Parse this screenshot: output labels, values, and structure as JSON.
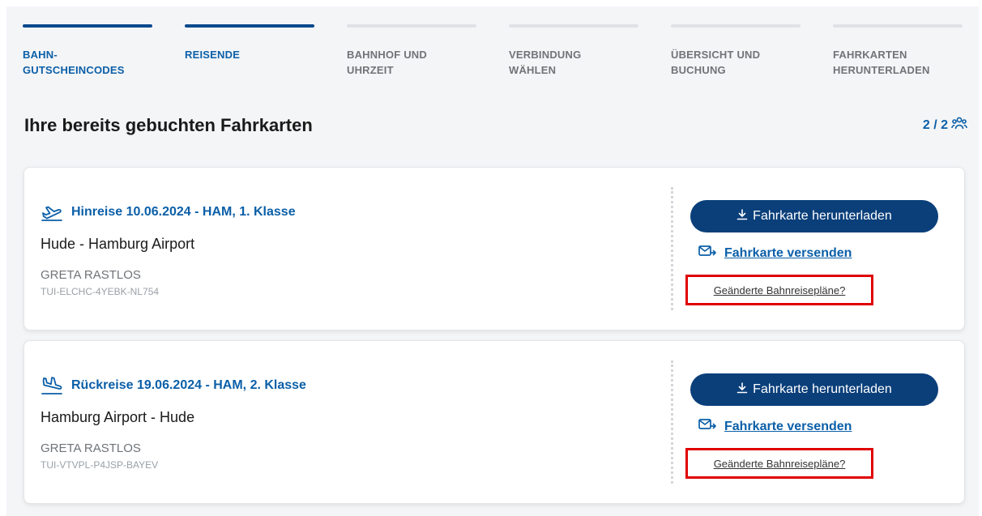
{
  "stepper": {
    "steps": [
      {
        "label": "BAHN-\nGUTSCHEINCODES",
        "state": "done"
      },
      {
        "label": "REISENDE",
        "state": "current"
      },
      {
        "label": "BAHNHOF UND\nUHRZEIT",
        "state": "upcoming"
      },
      {
        "label": "VERBINDUNG\nWÄHLEN",
        "state": "upcoming"
      },
      {
        "label": "ÜBERSICHT UND\nBUCHUNG",
        "state": "upcoming"
      },
      {
        "label": "FAHRKARTEN\nHERUNTERLADEN",
        "state": "upcoming"
      }
    ]
  },
  "section": {
    "title": "Ihre bereits gebuchten Fahrkarten",
    "counter": "2 / 2",
    "counter_icon": "group-icon"
  },
  "tickets": [
    {
      "icon": "plane-departure-icon",
      "trip": "Hinreise 10.06.2024 - HAM, 1. Klasse",
      "route": "Hude - Hamburg Airport",
      "traveler": "GRETA RASTLOS",
      "reference": "TUI-ELCHC-4YEBK-NL754",
      "download_label": "Fahrkarte herunterladen",
      "send_label": "Fahrkarte versenden",
      "changed_label": "Geänderte Bahnreisepläne?"
    },
    {
      "icon": "plane-arrival-icon",
      "trip": "Rückreise 19.06.2024 - HAM, 2. Klasse",
      "route": "Hamburg Airport - Hude",
      "traveler": "GRETA RASTLOS",
      "reference": "TUI-VTVPL-P4JSP-BAYEV",
      "download_label": "Fahrkarte herunterladen",
      "send_label": "Fahrkarte versenden",
      "changed_label": "Geänderte Bahnreisepläne?"
    }
  ],
  "colors": {
    "primary": "#0a3f7a",
    "accent": "#0b5fa8",
    "highlight_border": "#e00000",
    "panel_bg": "#f4f5f7"
  }
}
